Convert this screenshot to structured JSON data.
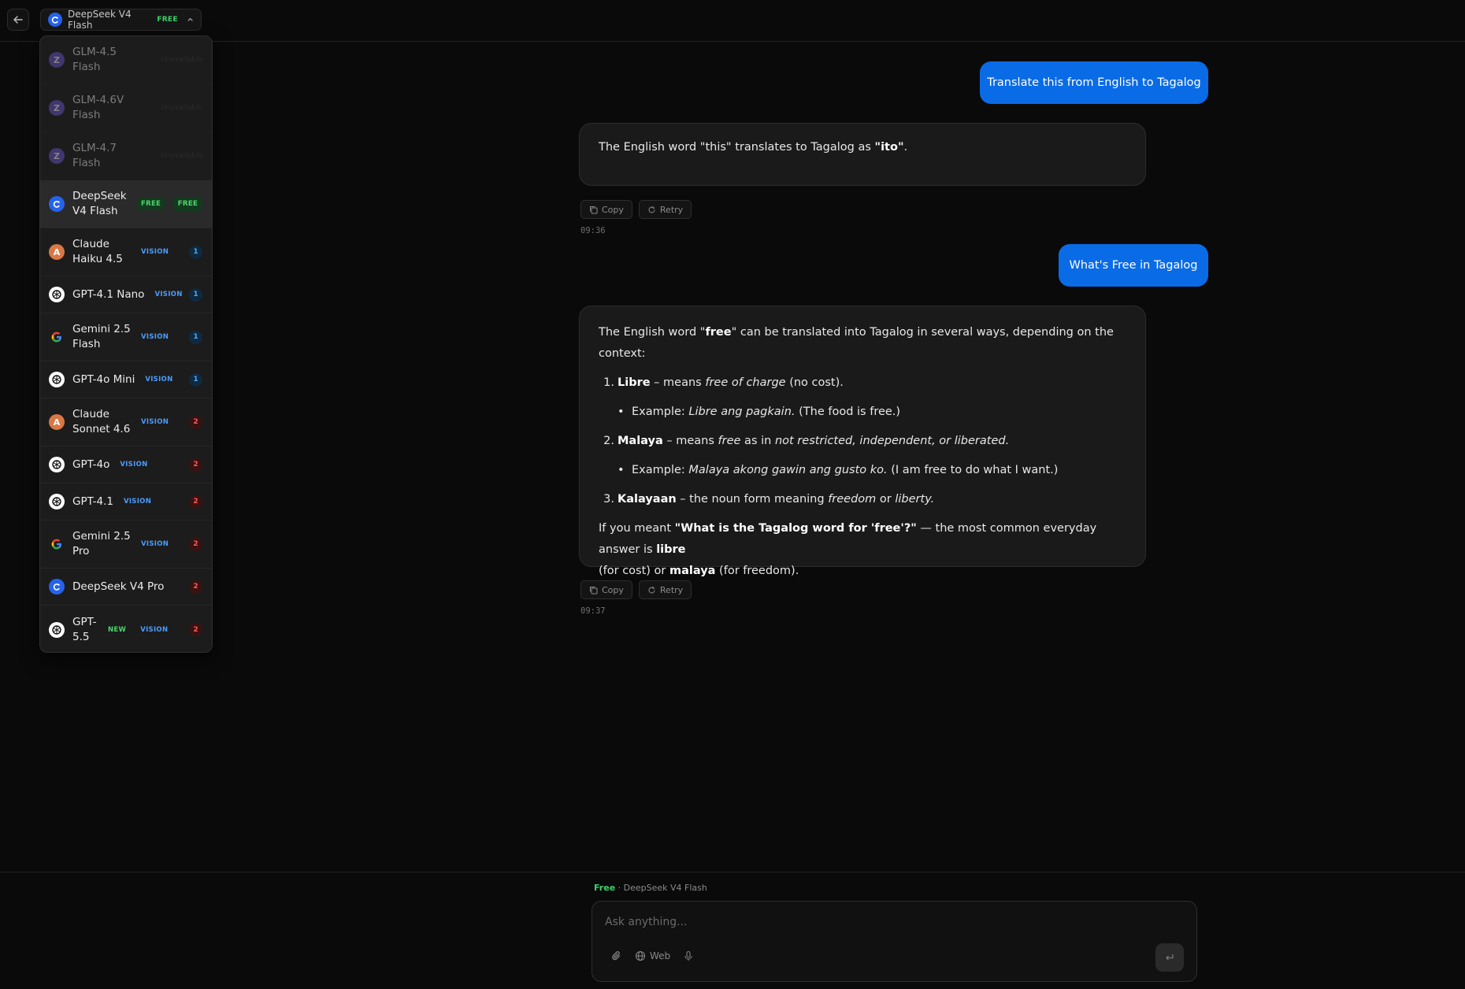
{
  "header": {
    "model_name": "DeepSeek V4 Flash",
    "model_badge": "FREE"
  },
  "dropdown": {
    "items": [
      {
        "name": "GLM-4.5 Flash",
        "status": "Unavailable"
      },
      {
        "name": "GLM-4.6V Flash",
        "status": "Unavailable"
      },
      {
        "name": "GLM-4.7 Flash",
        "status": "Unavailable"
      },
      {
        "name": "DeepSeek V4 Flash",
        "tag": "FREE",
        "tier": "FREE"
      },
      {
        "name": "Claude Haiku 4.5",
        "tag": "VISION",
        "tier": "1"
      },
      {
        "name": "GPT-4.1 Nano",
        "tag": "VISION",
        "tier": "1"
      },
      {
        "name": "Gemini 2.5 Flash",
        "tag": "VISION",
        "tier": "1"
      },
      {
        "name": "GPT-4o Mini",
        "tag": "VISION",
        "tier": "1"
      },
      {
        "name": "Claude Sonnet 4.6",
        "tag": "VISION",
        "tier": "2"
      },
      {
        "name": "GPT-4o",
        "tag": "VISION",
        "tier": "2"
      },
      {
        "name": "GPT-4.1",
        "tag": "VISION",
        "tier": "2"
      },
      {
        "name": "Gemini 2.5 Pro",
        "tag": "VISION",
        "tier": "2"
      },
      {
        "name": "DeepSeek V4 Pro",
        "tier": "2"
      },
      {
        "name": "GPT-5.5",
        "tag": "NEW",
        "tag2": "VISION",
        "tier": "2"
      }
    ]
  },
  "chat": {
    "msg1_user": "Translate this from English to Tagalog",
    "msg1_ai": {
      "pre": "The English word \"this\" translates to Tagalog as ",
      "bold": "\"ito\"",
      "post": "."
    },
    "msg1_time": "09:36",
    "msg2_user": "What's Free in Tagalog",
    "msg2_ai": {
      "intro_pre": "The English word \"",
      "intro_bold": "free",
      "intro_post": "\" can be translated into Tagalog in several ways, depending on the context:",
      "item1_num": "1.",
      "item1_bold": "Libre",
      "item1_mid": " – means ",
      "item1_ital": "free of charge",
      "item1_post": " (no cost).",
      "item1_ex_pre": "Example: ",
      "item1_ex_ital": "Libre ang pagkain.",
      "item1_ex_post": " (The food is free.)",
      "item2_num": "2.",
      "item2_bold": "Malaya",
      "item2_mid": " – means ",
      "item2_ital1": "free",
      "item2_mid2": " as in ",
      "item2_ital2": "not restricted, independent, or liberated.",
      "item2_ex_pre": "Example: ",
      "item2_ex_ital": "Malaya akong gawin ang gusto ko.",
      "item2_ex_post": " (I am free to do what I want.)",
      "item3_num": "3.",
      "item3_bold": "Kalayaan",
      "item3_mid": " – the noun form meaning ",
      "item3_ital1": "freedom",
      "item3_mid2": " or ",
      "item3_ital2": "liberty.",
      "outro_pre": "If you meant ",
      "outro_bold": "\"What is the Tagalog word for 'free'?\"",
      "outro_mid": " — the most common everyday answer is ",
      "outro_bold2": "libre",
      "outro_mid2": "(for cost) or ",
      "outro_bold3": "malaya",
      "outro_post": " (for freedom)."
    },
    "msg2_time": "09:37",
    "copy_label": "Copy",
    "retry_label": "Retry"
  },
  "composer": {
    "tier_label": "Free",
    "separator": " · ",
    "model_label": "DeepSeek V4 Flash",
    "placeholder": "Ask anything...",
    "web_label": "Web"
  },
  "colors": {
    "accent": "#0a6be6",
    "free_green": "#3ed16a",
    "vision_blue": "#4a9cff",
    "tier2_red": "#ff5a5a",
    "background": "#0a0a0a"
  }
}
